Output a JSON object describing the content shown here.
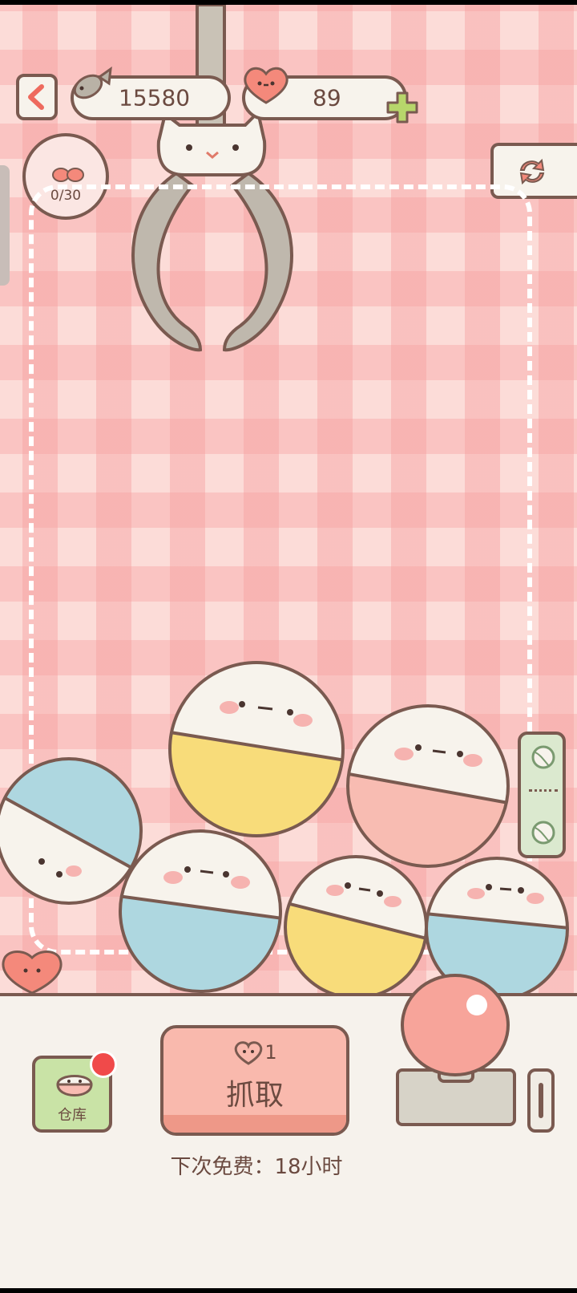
{
  "header": {
    "fish_count": "15580",
    "heart_count": "89"
  },
  "quota": {
    "text": "0/30"
  },
  "actions": {
    "grab_cost": "1",
    "grab_label": "抓取",
    "free_info": "下次免费：18小时",
    "storage_label": "仓库"
  },
  "icons": {
    "back": "back-arrow-icon",
    "currency_fish": "fish-icon",
    "currency_heart": "heart-icon",
    "add": "plus-icon",
    "refresh": "refresh-icon"
  },
  "colors": {
    "accent": "#f9b9ad",
    "outline": "#7a5a50",
    "plus": "#b7d66b",
    "badge": "#f04a4a"
  }
}
